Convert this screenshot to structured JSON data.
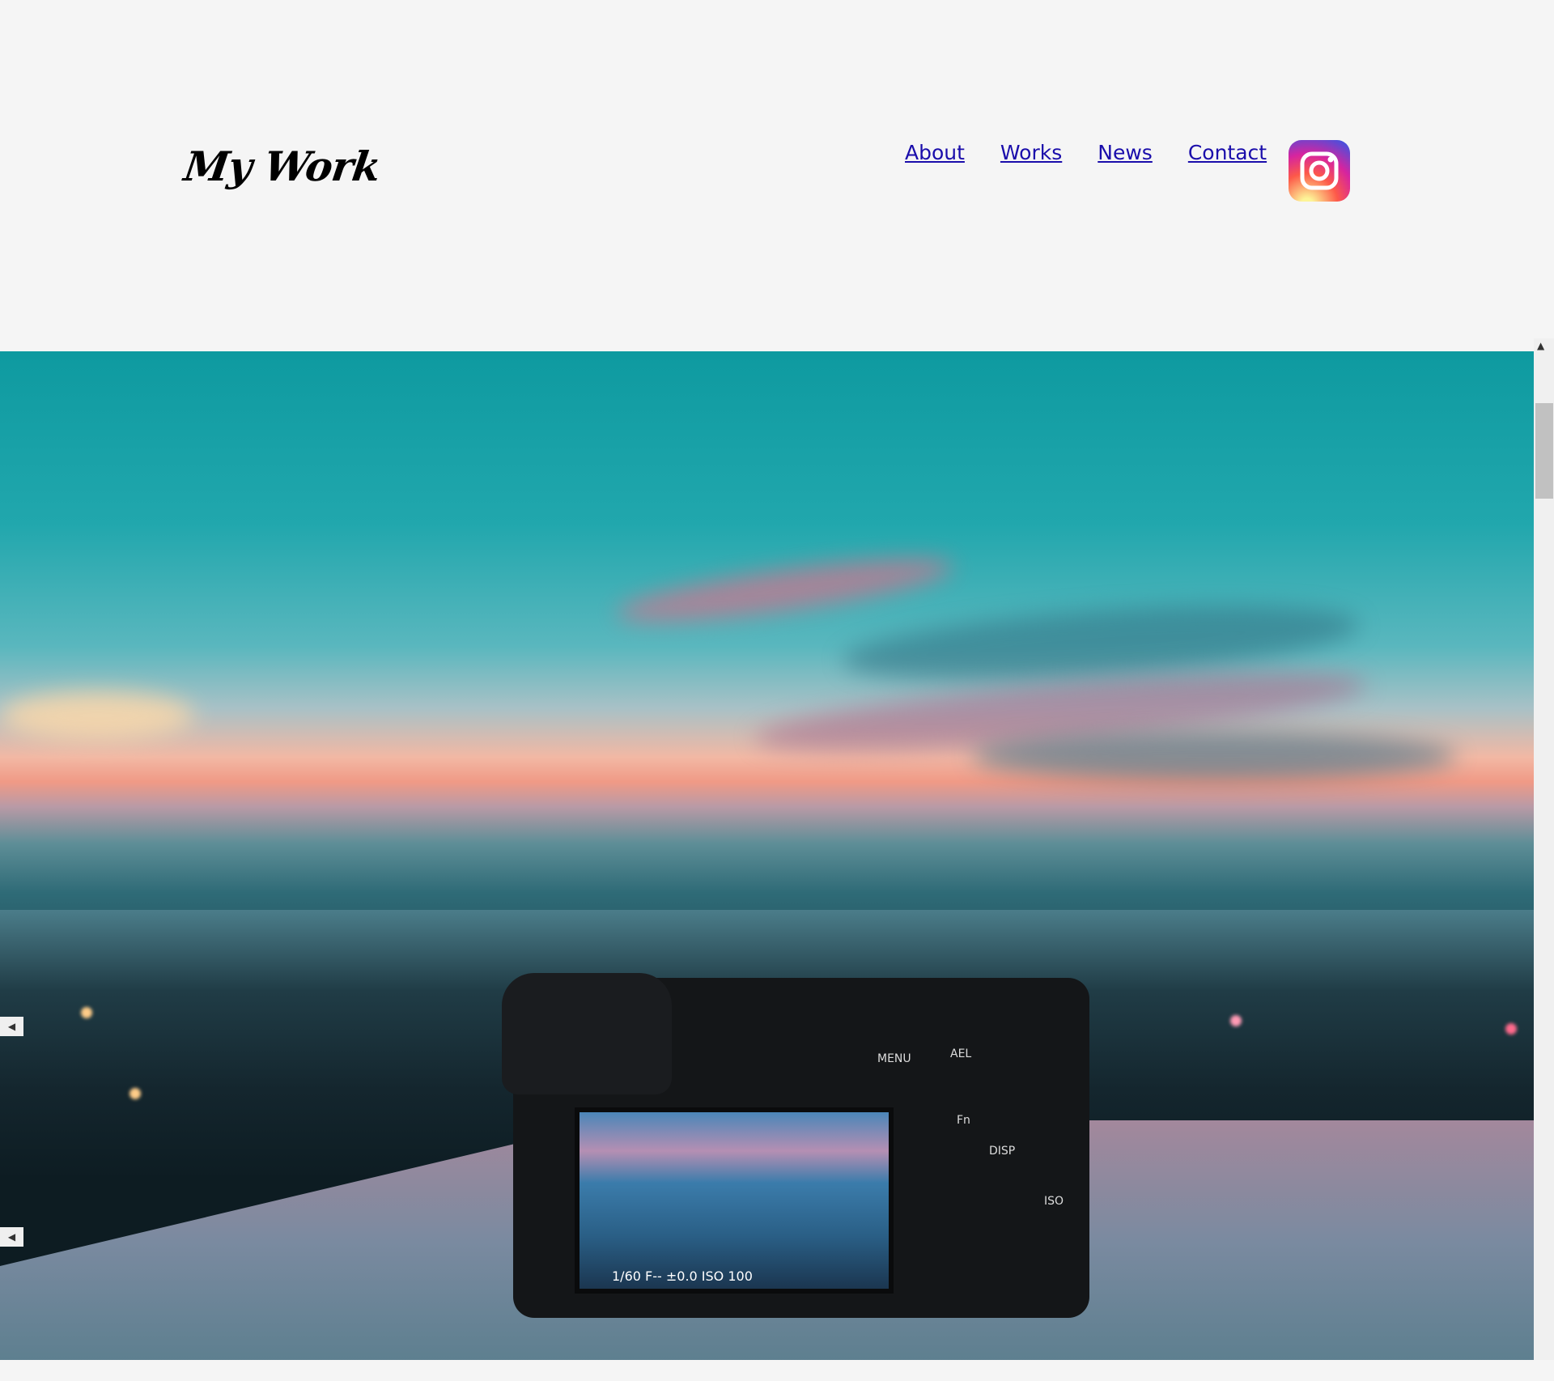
{
  "header": {
    "logo": "My Work",
    "nav": [
      "About",
      "Works",
      "News",
      "Contact"
    ]
  },
  "social": {
    "icon": "instagram-icon"
  },
  "hero": {
    "camera_screen_readout": "1/60   F--   ±0.0   ISO 100",
    "camera_menu_label": "MENU",
    "camera_ael_label": "AEL",
    "camera_fn_label": "Fn",
    "camera_disp_label": "DISP",
    "camera_iso_label": "ISO"
  },
  "colors": {
    "link": "#1a0dab",
    "background": "#f5f5f5",
    "sky": "#1fa6ad"
  }
}
